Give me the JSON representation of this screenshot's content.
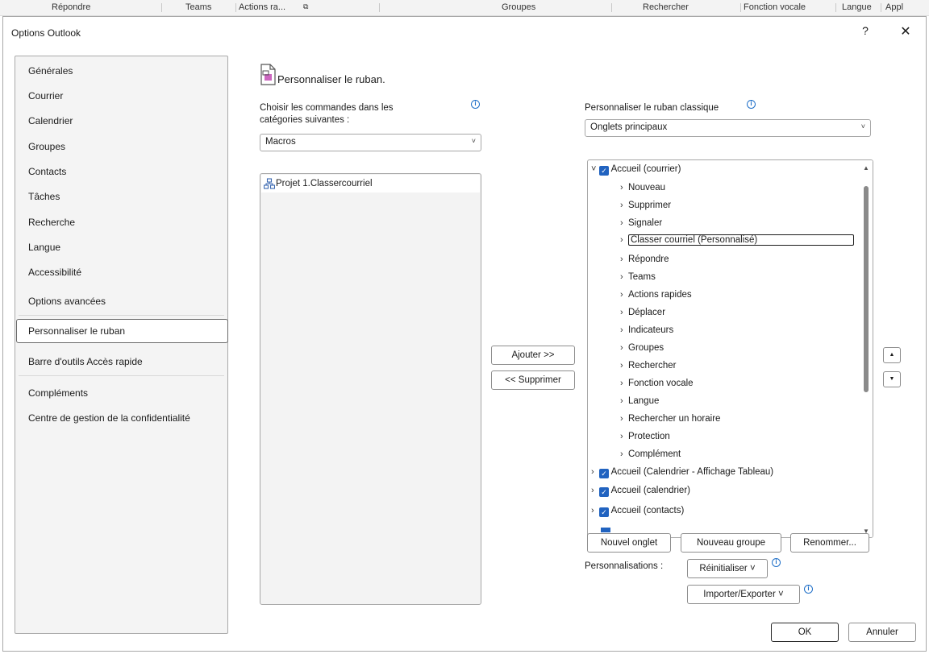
{
  "ribbon_tabs": [
    "Répondre",
    "Teams",
    "Actions ra...",
    "Groupes",
    "Rechercher",
    "Fonction vocale",
    "Langue",
    "Appl"
  ],
  "dialog": {
    "title": "Options Outlook",
    "help": "?",
    "close": "✕"
  },
  "nav": {
    "items": [
      "Générales",
      "Courrier",
      "Calendrier",
      "Groupes",
      "Contacts",
      "Tâches",
      "Recherche",
      "Langue",
      "Accessibilité",
      "Options avancées",
      "Personnaliser le ruban",
      "Barre d'outils Accès rapide",
      "Compléments",
      "Centre de gestion de la confidentialité"
    ],
    "selected": "Personnaliser le ruban"
  },
  "page": {
    "title": "Personnaliser le ruban."
  },
  "commands": {
    "label_line1": "Choisir les commandes dans les",
    "label_line2": "catégories suivantes :",
    "selected": "Macros",
    "list": [
      "Projet 1.Classercourriel"
    ]
  },
  "transfer": {
    "add": "Ajouter >>",
    "remove": "<< Supprimer"
  },
  "ribbon": {
    "label": "Personnaliser le ruban classique",
    "selected": "Onglets principaux",
    "tree": [
      {
        "label": "Accueil (courrier)",
        "level": 0,
        "expanded": true,
        "checked": true
      },
      {
        "label": "Nouveau",
        "level": 1
      },
      {
        "label": "Supprimer",
        "level": 1
      },
      {
        "label": "Signaler",
        "level": 1
      },
      {
        "label": "Classer courriel (Personnalisé)",
        "level": 1,
        "focused": true
      },
      {
        "label": "Répondre",
        "level": 1
      },
      {
        "label": "Teams",
        "level": 1
      },
      {
        "label": "Actions rapides",
        "level": 1
      },
      {
        "label": "Déplacer",
        "level": 1
      },
      {
        "label": "Indicateurs",
        "level": 1
      },
      {
        "label": "Groupes",
        "level": 1
      },
      {
        "label": "Rechercher",
        "level": 1
      },
      {
        "label": "Fonction vocale",
        "level": 1
      },
      {
        "label": "Langue",
        "level": 1
      },
      {
        "label": "Rechercher un horaire",
        "level": 1
      },
      {
        "label": "Protection",
        "level": 1
      },
      {
        "label": "Complément",
        "level": 1
      },
      {
        "label": "Accueil (Calendrier - Affichage Tableau)",
        "level": 0,
        "checked": true
      },
      {
        "label": "Accueil (calendrier)",
        "level": 0,
        "checked": true
      },
      {
        "label": "Accueil (contacts)",
        "level": 0,
        "checked": true
      }
    ],
    "new_tab": "Nouvel onglet",
    "new_group": "Nouveau groupe",
    "rename": "Renommer...",
    "customizations_label": "Personnalisations :",
    "reset": "Réinitialiser ˅",
    "import_export": "Importer/Exporter ˅"
  },
  "footer": {
    "ok": "OK",
    "cancel": "Annuler"
  }
}
